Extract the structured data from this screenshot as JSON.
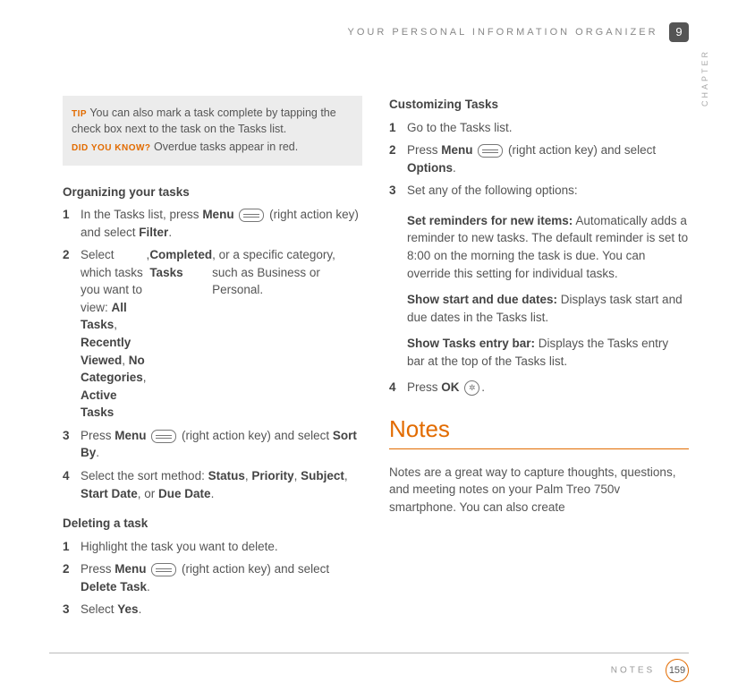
{
  "header": {
    "title": "YOUR PERSONAL INFORMATION ORGANIZER",
    "chapter_number": "9",
    "chapter_label": "CHAPTER"
  },
  "tipbox": {
    "tip_label": "TIP",
    "tip_text": "You can also mark a task complete by tapping the check box next to the task on the Tasks list.",
    "dyk_label": "DID YOU KNOW?",
    "dyk_text": "Overdue tasks appear in red."
  },
  "organizing": {
    "heading": "Organizing your tasks",
    "s1a": "In the Tasks list, press ",
    "s1b": "Menu",
    "s1c": " (right action key) and select ",
    "s1d": "Filter",
    "s1e": ".",
    "s2a": "Select which tasks you want to view: ",
    "s2b": "All Tasks",
    "s2c": ", ",
    "s2d": "Recently Viewed",
    "s2e": ", ",
    "s2f": "No Categories",
    "s2g": ", ",
    "s2h": "Active Tasks",
    "s2i": ", ",
    "s2j": "Completed Tasks",
    "s2k": ", or a specific category, such as Business or Personal.",
    "s3a": "Press ",
    "s3b": "Menu",
    "s3c": " (right action key) and select ",
    "s3d": "Sort By",
    "s3e": ".",
    "s4a": "Select the sort method: ",
    "s4b": "Status",
    "s4c": ", ",
    "s4d": "Priority",
    "s4e": ", ",
    "s4f": "Subject",
    "s4g": ", ",
    "s4h": "Start Date",
    "s4i": ", or ",
    "s4j": "Due Date",
    "s4k": "."
  },
  "deleting": {
    "heading": "Deleting a task",
    "s1": "Highlight the task you want to delete.",
    "s2a": "Press ",
    "s2b": "Menu",
    "s2c": " (right action key) and select ",
    "s2d": "Delete Task",
    "s2e": ".",
    "s3a": "Select ",
    "s3b": "Yes",
    "s3c": "."
  },
  "customizing": {
    "heading": "Customizing Tasks",
    "s1": "Go to the Tasks list.",
    "s2a": "Press ",
    "s2b": "Menu",
    "s2c": " (right action key) and select ",
    "s2d": "Options",
    "s2e": ".",
    "s3": "Set any of the following options:",
    "opt1_label": "Set reminders for new items:",
    "opt1_text": " Automatically adds a reminder to new tasks. The default reminder is set to 8:00 on the morning the task is due. You can override this setting for individual tasks.",
    "opt2_label": "Show start and due dates:",
    "opt2_text": " Displays task start and due dates in the Tasks list.",
    "opt3_label": "Show Tasks entry bar:",
    "opt3_text": " Displays the Tasks entry bar at the top of the Tasks list.",
    "s4a": "Press ",
    "s4b": "OK",
    "s4c": "."
  },
  "notes": {
    "title": "Notes",
    "intro": "Notes are a great way to capture thoughts, questions, and meeting notes on your Palm Treo 750v smartphone. You can also create"
  },
  "footer": {
    "section": "NOTES",
    "page": "159"
  },
  "nums": {
    "n1": "1",
    "n2": "2",
    "n3": "3",
    "n4": "4"
  }
}
